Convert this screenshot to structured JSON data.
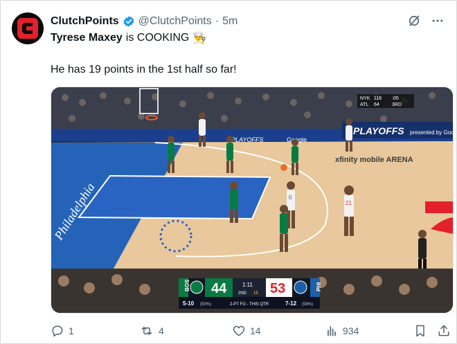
{
  "account": {
    "display_name": "ClutchPoints",
    "handle": "@ClutchPoints",
    "separator": "·",
    "time": "5m"
  },
  "tweet": {
    "line1_name": "Tyrese Maxey",
    "line1_rest": "is COOKING",
    "line1_emoji": "👨‍🍳",
    "line2": "He has 19 points in the 1st half so far!"
  },
  "media": {
    "top_ticker": {
      "team1": "NYK",
      "score1": "116",
      "team2": "ATL",
      "score2": "64",
      "clock": ":05",
      "period": "3RD"
    },
    "signage": {
      "playoffs": "PLAYOFFS",
      "presented": "presented by Google",
      "arena": "xfinity mobile ARENA",
      "baseline": "PLAYOFFS",
      "baseline2": "Google",
      "courtside": "Philadelphia"
    },
    "scorebug": {
      "away_abbr": "BOS",
      "away_score": "44",
      "home_score": "53",
      "home_abbr": "PHI",
      "clock": "1:11",
      "period": "2ND",
      "shot_clock": "15",
      "away_stat": "5-10",
      "away_pct": "(50%)",
      "stat_label": "2-PT FG - THIS QTR",
      "home_stat": "7-12",
      "home_pct": "(58%)"
    },
    "jerseys": {
      "maxey": "0",
      "embiid": "21"
    }
  },
  "actions": {
    "replies": "1",
    "reposts": "4",
    "likes": "14",
    "views": "934"
  },
  "colors": {
    "brand_red": "#e4202b",
    "celtics_green": "#0a7a43",
    "sixers_blue": "#1d5fa9",
    "text_secondary": "#536471",
    "verified_blue": "#1d9bf0"
  },
  "icons": [
    "clutchpoints-logo",
    "verified-badge-icon",
    "grok-icon",
    "more-icon",
    "reply-icon",
    "repost-icon",
    "like-icon",
    "views-icon",
    "bookmark-icon",
    "share-icon"
  ]
}
